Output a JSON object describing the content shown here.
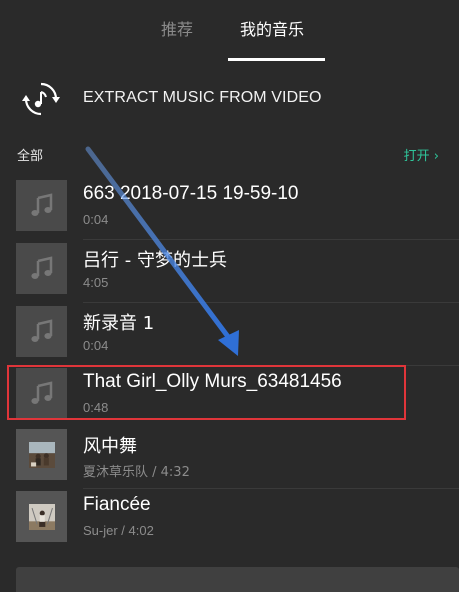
{
  "tabs": [
    {
      "label": "推荐",
      "active": false
    },
    {
      "label": "我的音乐",
      "active": true
    }
  ],
  "extract": {
    "label": "EXTRACT MUSIC FROM VIDEO",
    "icon": "extract-music-icon"
  },
  "section": {
    "all_label": "全部",
    "open_label": "打开 ›"
  },
  "tracks": [
    {
      "title": "663 2018-07-15 19-59-10",
      "subtitle": "0:04",
      "thumb": "music-note-icon"
    },
    {
      "title": "吕行 - 守梦的士兵",
      "subtitle": "4:05",
      "thumb": "music-note-icon"
    },
    {
      "title": "新录音 1",
      "subtitle": "0:04",
      "thumb": "music-note-icon"
    },
    {
      "title": "That Girl_Olly Murs_63481456",
      "subtitle": "0:48",
      "thumb": "music-note-icon",
      "highlighted": true
    },
    {
      "title": "风中舞",
      "subtitle": "夏沐草乐队 / 4:32",
      "thumb": "album-cover"
    },
    {
      "title": "Fiancée",
      "subtitle": "Su-jer / 4:02",
      "thumb": "album-cover"
    }
  ],
  "colors": {
    "background": "#2a2a2a",
    "accent": "#2fc59a",
    "highlight": "#e0353a",
    "annotation_arrow": "#2f6fd6"
  }
}
